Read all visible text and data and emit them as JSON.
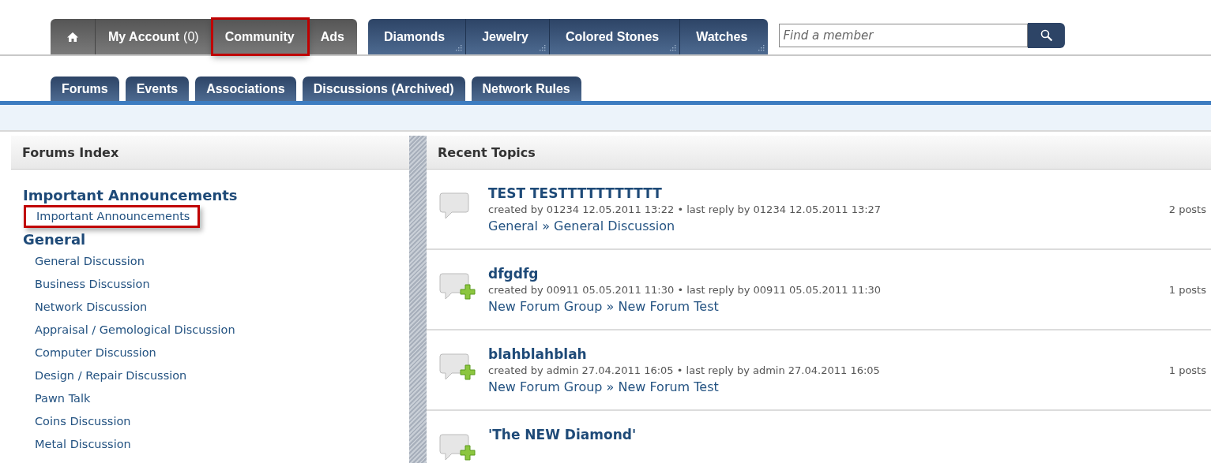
{
  "main_nav": {
    "account_tabs": [
      {
        "kind": "home",
        "highlighted": false
      },
      {
        "kind": "text",
        "label": "My Account",
        "count": "(0)",
        "highlighted": false
      },
      {
        "kind": "text",
        "label": "Community",
        "highlighted": true
      },
      {
        "kind": "text",
        "label": "Ads",
        "highlighted": false
      }
    ],
    "market_tabs": [
      {
        "label": "Diamonds"
      },
      {
        "label": "Jewelry"
      },
      {
        "label": "Colored Stones"
      },
      {
        "label": "Watches"
      }
    ],
    "search": {
      "placeholder": "Find a member"
    }
  },
  "sub_tabs": [
    {
      "label": "Forums"
    },
    {
      "label": "Events"
    },
    {
      "label": "Associations"
    },
    {
      "label": "Discussions (Archived)"
    },
    {
      "label": "Network Rules"
    }
  ],
  "forums_index": {
    "title": "Forums Index",
    "groups": [
      {
        "title": "Important Announcements",
        "children": [
          {
            "label": "Important Announcements",
            "highlighted": true
          }
        ]
      },
      {
        "title": "General",
        "children": [
          {
            "label": "General Discussion",
            "highlighted": false
          },
          {
            "label": "Business Discussion",
            "highlighted": false
          },
          {
            "label": "Network Discussion",
            "highlighted": false
          },
          {
            "label": "Appraisal / Gemological Discussion",
            "highlighted": false
          },
          {
            "label": "Computer Discussion",
            "highlighted": false
          },
          {
            "label": "Design / Repair Discussion",
            "highlighted": false
          },
          {
            "label": "Pawn Talk",
            "highlighted": false
          },
          {
            "label": "Coins Discussion",
            "highlighted": false
          },
          {
            "label": "Metal Discussion",
            "highlighted": false
          }
        ]
      }
    ]
  },
  "recent_topics": {
    "title": "Recent Topics",
    "topics": [
      {
        "kind": "plain",
        "title": "TEST TESTTTTTTTTTTT",
        "meta": "created by 01234 12.05.2011 13:22 • last reply by 01234 12.05.2011 13:27",
        "posts": "2 posts",
        "path": "General » General Discussion"
      },
      {
        "kind": "new",
        "title": "dfgdfg",
        "meta": "created by 00911 05.05.2011 11:30 • last reply by 00911 05.05.2011 11:30",
        "posts": "1 posts",
        "path": "New Forum Group » New Forum Test"
      },
      {
        "kind": "new",
        "title": "blahblahblah",
        "meta": "created by admin 27.04.2011 16:05 • last reply by admin 27.04.2011 16:05",
        "posts": "1 posts",
        "path": "New Forum Group » New Forum Test"
      },
      {
        "kind": "new",
        "title": "'The NEW Diamond'"
      }
    ]
  }
}
